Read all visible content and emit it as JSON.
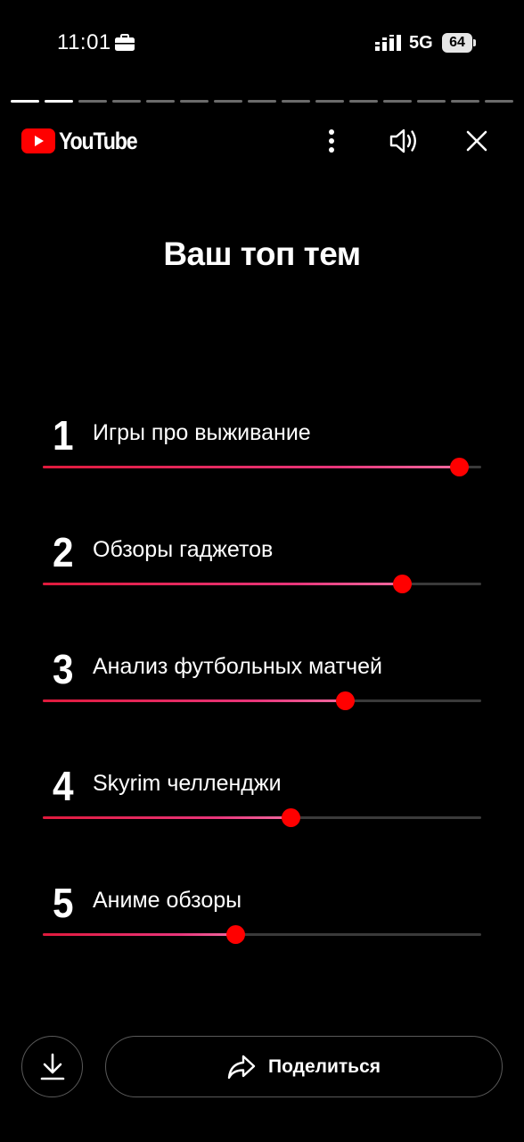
{
  "status_bar": {
    "time": "11:01",
    "network": "5G",
    "battery": "64",
    "icons": [
      "briefcase-icon",
      "signal-icon",
      "battery-icon"
    ]
  },
  "story": {
    "segments_total": 15,
    "segments_done": 2
  },
  "header": {
    "logo_text": "YouTube",
    "brand_color": "#ff0000",
    "icons": [
      "more-vertical-icon",
      "volume-icon",
      "close-icon"
    ]
  },
  "title": "Ваш топ тем",
  "topics": [
    {
      "rank": "1",
      "name": "Игры про выживание",
      "level": 0.95
    },
    {
      "rank": "2",
      "name": "Обзоры гаджетов",
      "level": 0.82
    },
    {
      "rank": "3",
      "name": "Анализ футбольных матчей",
      "level": 0.69
    },
    {
      "rank": "4",
      "name": "Skyrim челленджи",
      "level": 0.565
    },
    {
      "rank": "5",
      "name": "Аниме обзоры",
      "level": 0.44
    }
  ],
  "colors": {
    "knob": "#ff0000",
    "fill_start": "#e01a3c",
    "fill_end": "#f06aa0",
    "track": "#3a3a3a"
  },
  "actions": {
    "share_label": "Поделиться",
    "icons": [
      "download-icon",
      "share-icon"
    ]
  }
}
